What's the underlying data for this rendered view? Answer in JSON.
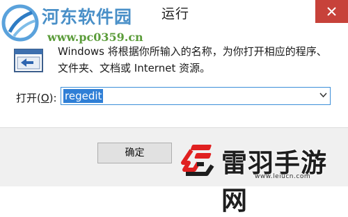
{
  "window": {
    "title": "运行",
    "close_icon": "close-icon"
  },
  "dialog": {
    "description": "Windows 将根据你所输入的名称，为你打开相应的程序、文件夹、文档或 Internet 资源。",
    "open_label_prefix": "打开(",
    "open_label_accel": "O",
    "open_label_suffix": "):",
    "input_value": "regedit",
    "ok_label": "确定"
  },
  "watermarks": {
    "top_left_name": "河东软件园",
    "top_left_url": "www.pc0359.cn",
    "bottom_right_name": "雷羽手游网",
    "bottom_right_url": "www.leiucn.com"
  },
  "colors": {
    "close_button": "#c7423a",
    "selection": "#2f7fd6",
    "input_border": "#3b8ed8",
    "brand_red": "#e02020"
  }
}
